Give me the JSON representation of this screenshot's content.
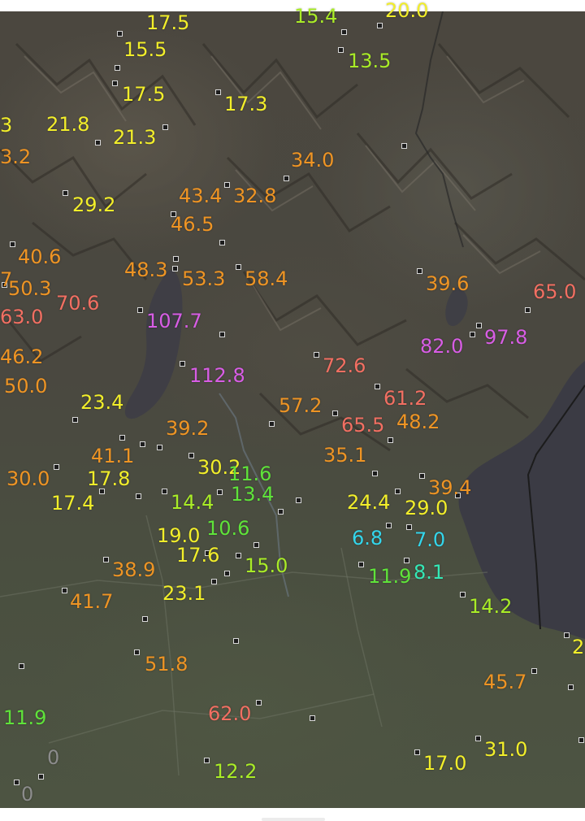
{
  "colors": {
    "yellow": "#f2ee2a",
    "lime": "#a9ec27",
    "green": "#5fe33a",
    "orange": "#ee9424",
    "salmon": "#f26f62",
    "magenta": "#d85de5",
    "cyan": "#33d6ec",
    "teal": "#34e8b6",
    "gray": "#8c8c8c"
  },
  "labels": [
    {
      "text": "17.5",
      "color": "yellow"
    },
    {
      "text": "15.4",
      "color": "lime"
    },
    {
      "text": "20.0",
      "color": "yellow"
    },
    {
      "text": "15.5",
      "color": "yellow"
    },
    {
      "text": "13.5",
      "color": "lime"
    },
    {
      "text": "17.5",
      "color": "yellow"
    },
    {
      "text": "17.3",
      "color": "yellow"
    },
    {
      "text": "3",
      "color": "yellow"
    },
    {
      "text": "21.8",
      "color": "yellow"
    },
    {
      "text": "21.3",
      "color": "yellow"
    },
    {
      "text": "3.2",
      "color": "orange"
    },
    {
      "text": "34.0",
      "color": "orange"
    },
    {
      "text": "43.4",
      "color": "orange"
    },
    {
      "text": "32.8",
      "color": "orange"
    },
    {
      "text": "29.2",
      "color": "yellow"
    },
    {
      "text": "46.5",
      "color": "orange"
    },
    {
      "text": "40.6",
      "color": "orange"
    },
    {
      "text": "48.3",
      "color": "orange"
    },
    {
      "text": "53.3",
      "color": "orange"
    },
    {
      "text": "58.4",
      "color": "orange"
    },
    {
      "text": "7",
      "color": "orange"
    },
    {
      "text": "50.3",
      "color": "orange"
    },
    {
      "text": "39.6",
      "color": "orange"
    },
    {
      "text": "65.0",
      "color": "salmon"
    },
    {
      "text": "70.6",
      "color": "salmon"
    },
    {
      "text": "63.0",
      "color": "salmon"
    },
    {
      "text": "107.7",
      "color": "magenta"
    },
    {
      "text": "82.0",
      "color": "magenta"
    },
    {
      "text": "97.8",
      "color": "magenta"
    },
    {
      "text": "46.2",
      "color": "orange"
    },
    {
      "text": "72.6",
      "color": "salmon"
    },
    {
      "text": "112.8",
      "color": "magenta"
    },
    {
      "text": "50.0",
      "color": "orange"
    },
    {
      "text": "61.2",
      "color": "salmon"
    },
    {
      "text": "23.4",
      "color": "yellow"
    },
    {
      "text": "57.2",
      "color": "orange"
    },
    {
      "text": "65.5",
      "color": "salmon"
    },
    {
      "text": "48.2",
      "color": "orange"
    },
    {
      "text": "39.2",
      "color": "orange"
    },
    {
      "text": "41.1",
      "color": "orange"
    },
    {
      "text": "35.1",
      "color": "orange"
    },
    {
      "text": "30.2",
      "color": "yellow"
    },
    {
      "text": "11.6",
      "color": "green"
    },
    {
      "text": "30.0",
      "color": "orange"
    },
    {
      "text": "17.8",
      "color": "yellow"
    },
    {
      "text": "39.4",
      "color": "orange"
    },
    {
      "text": "13.4",
      "color": "green"
    },
    {
      "text": "17.4",
      "color": "yellow"
    },
    {
      "text": "14.4",
      "color": "lime"
    },
    {
      "text": "24.4",
      "color": "yellow"
    },
    {
      "text": "29.0",
      "color": "yellow"
    },
    {
      "text": "10.6",
      "color": "green"
    },
    {
      "text": "19.0",
      "color": "yellow"
    },
    {
      "text": "6.8",
      "color": "cyan"
    },
    {
      "text": "7.0",
      "color": "cyan"
    },
    {
      "text": "17.6",
      "color": "yellow"
    },
    {
      "text": "15.0",
      "color": "lime"
    },
    {
      "text": "38.9",
      "color": "orange"
    },
    {
      "text": "8.1",
      "color": "teal"
    },
    {
      "text": "11.9",
      "color": "green"
    },
    {
      "text": "23.1",
      "color": "yellow"
    },
    {
      "text": "41.7",
      "color": "orange"
    },
    {
      "text": "14.2",
      "color": "lime"
    },
    {
      "text": "2",
      "color": "yellow"
    },
    {
      "text": "51.8",
      "color": "orange"
    },
    {
      "text": "45.7",
      "color": "orange"
    },
    {
      "text": "11.9",
      "color": "green"
    },
    {
      "text": "62.0",
      "color": "salmon"
    },
    {
      "text": "0",
      "color": "gray"
    },
    {
      "text": "0",
      "color": "gray"
    },
    {
      "text": "17.0",
      "color": "yellow"
    },
    {
      "text": "31.0",
      "color": "yellow"
    },
    {
      "text": "12.2",
      "color": "lime"
    }
  ]
}
